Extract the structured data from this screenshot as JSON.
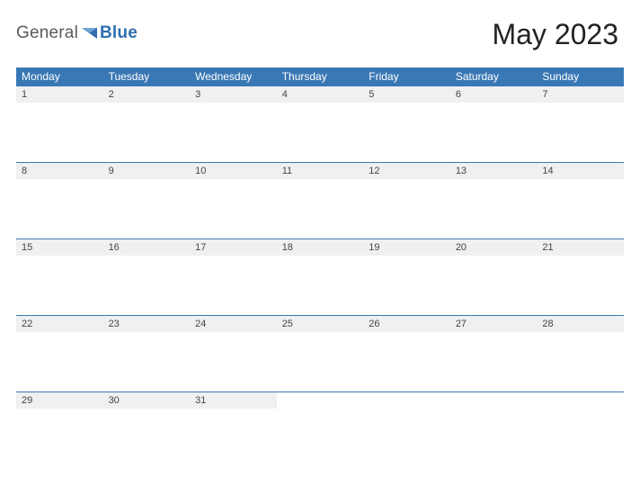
{
  "logo": {
    "part1": "General",
    "part2": "Blue"
  },
  "title": "May 2023",
  "weekdays": [
    "Monday",
    "Tuesday",
    "Wednesday",
    "Thursday",
    "Friday",
    "Saturday",
    "Sunday"
  ],
  "weeks": [
    [
      "1",
      "2",
      "3",
      "4",
      "5",
      "6",
      "7"
    ],
    [
      "8",
      "9",
      "10",
      "11",
      "12",
      "13",
      "14"
    ],
    [
      "15",
      "16",
      "17",
      "18",
      "19",
      "20",
      "21"
    ],
    [
      "22",
      "23",
      "24",
      "25",
      "26",
      "27",
      "28"
    ],
    [
      "29",
      "30",
      "31",
      "",
      "",
      "",
      ""
    ]
  ]
}
